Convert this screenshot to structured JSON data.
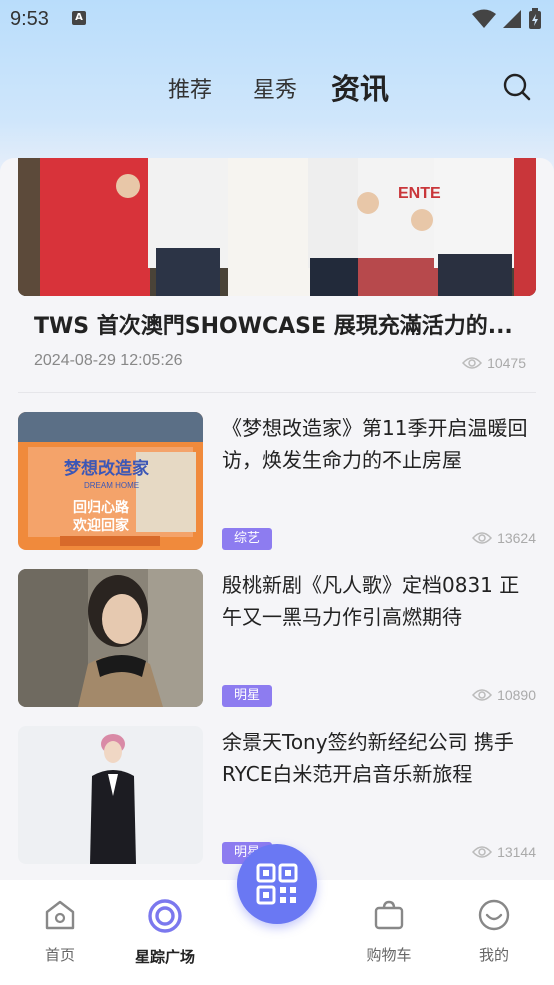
{
  "status": {
    "time": "9:53",
    "notif_letter": "A"
  },
  "top_tabs": [
    {
      "label": "推荐",
      "active": false
    },
    {
      "label": "星秀",
      "active": false
    },
    {
      "label": "资讯",
      "active": true
    }
  ],
  "hero": {
    "title": "TWS 首次澳門SHOWCASE  展現充滿活力的...",
    "date": "2024-08-29 12:05:26",
    "views": "10475"
  },
  "articles": [
    {
      "title": "《梦想改造家》第11季开启温暖回访，焕发生命力的不止房屋",
      "tag": "综艺",
      "views": "13624"
    },
    {
      "title": "殷桃新剧《凡人歌》定档0831 正午又一黑马力作引高燃期待",
      "tag": "明星",
      "views": "10890"
    },
    {
      "title": "余景天Tony签约新经纪公司 携手RYCE白米范开启音乐新旅程",
      "tag": "明星",
      "views": "13144"
    }
  ],
  "bottom_nav": [
    {
      "label": "首页",
      "icon": "home-icon",
      "active": false
    },
    {
      "label": "星踪广场",
      "icon": "target-icon",
      "active": true
    },
    {
      "label": "",
      "icon": "qr-code-icon",
      "active": false
    },
    {
      "label": "购物车",
      "icon": "cart-icon",
      "active": false
    },
    {
      "label": "我的",
      "icon": "smile-icon",
      "active": false
    }
  ],
  "colors": {
    "accent": "#6a78f3",
    "tag": "#8d7cf0",
    "active_icon": "#7b78ee"
  }
}
